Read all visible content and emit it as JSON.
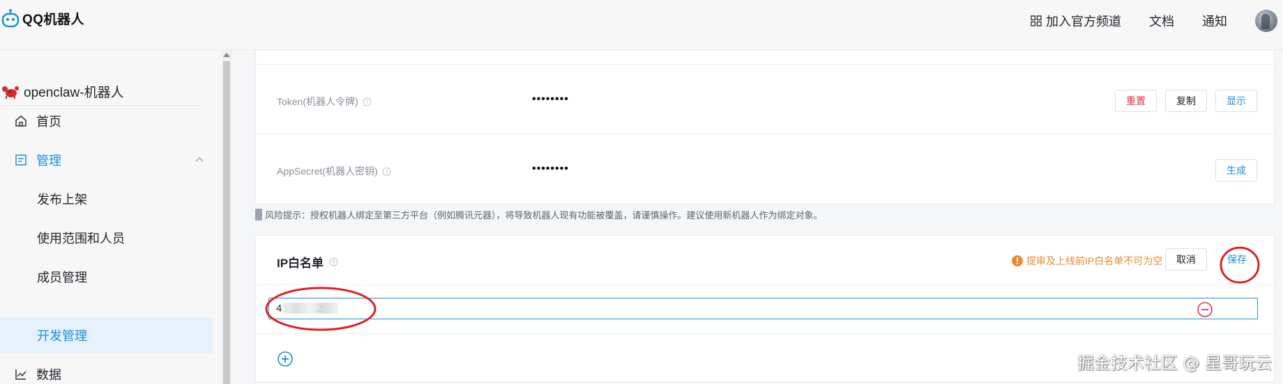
{
  "header": {
    "app_title": "QQ机器人",
    "nav": {
      "channel": "加入官方频道",
      "docs": "文档",
      "notice": "通知"
    }
  },
  "sidebar": {
    "bot_name": "openclaw-机器人",
    "items": [
      {
        "label": "首页"
      },
      {
        "label": "管理"
      },
      {
        "label": "发布上架"
      },
      {
        "label": "使用范围和人员"
      },
      {
        "label": "成员管理"
      },
      {
        "label": "开发管理"
      },
      {
        "label": "数据"
      }
    ]
  },
  "credentials": {
    "token_label": "Token(机器人令牌)",
    "token_value": "••••••••",
    "token_buttons": {
      "reset": "重置",
      "copy": "复制",
      "show": "显示"
    },
    "secret_label": "AppSecret(机器人密钥)",
    "secret_value": "••••••••",
    "secret_buttons": {
      "generate": "生成"
    }
  },
  "risk_notice": "风险提示：授权机器人绑定至第三方平台（例如腾讯元器），将导致机器人现有功能被覆盖，请谨慎操作。建议使用新机器人作为绑定对象。",
  "ip_whitelist": {
    "title": "IP白名单",
    "warning": "提审及上线前IP白名单不可为空",
    "cancel_label": "取消",
    "save_label": "保存",
    "input_value": "43          2"
  },
  "watermark": "掘金技术社区 @ 星哥玩云",
  "colors": {
    "accent": "#1a8fd6",
    "danger": "#e0334a",
    "warning": "#e88b2f",
    "annotation_red": "#e02020"
  }
}
